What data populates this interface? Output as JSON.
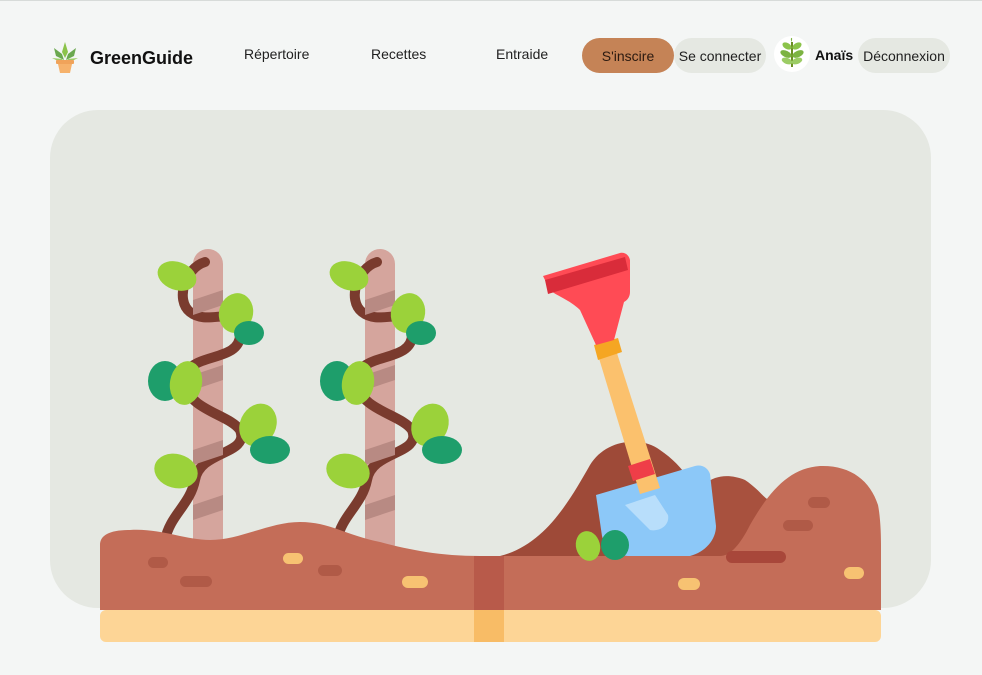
{
  "brand": {
    "name": "GreenGuide",
    "logo_icon": "potted-succulent-icon"
  },
  "nav": {
    "links": [
      {
        "label": "Répertoire"
      },
      {
        "label": "Recettes"
      },
      {
        "label": "Entraide"
      }
    ]
  },
  "auth": {
    "signup_label": "S'inscire",
    "login_label": "Se connecter",
    "user_name": "Anaïs",
    "avatar_icon": "sprout-icon",
    "logout_label": "Déconnexion"
  },
  "hero": {
    "illustration_icons": [
      "climbing-plant-icon",
      "climbing-plant-icon",
      "shovel-icon",
      "soil-icon"
    ]
  },
  "colors": {
    "background": "#f4f6f5",
    "hero_panel": "#e5e8e2",
    "signup_button": "#c58356",
    "secondary_button": "#e5e8e2",
    "soil": "#c46d58",
    "leaf_green": "#9bd23a",
    "shovel_red": "#ff4b55"
  }
}
